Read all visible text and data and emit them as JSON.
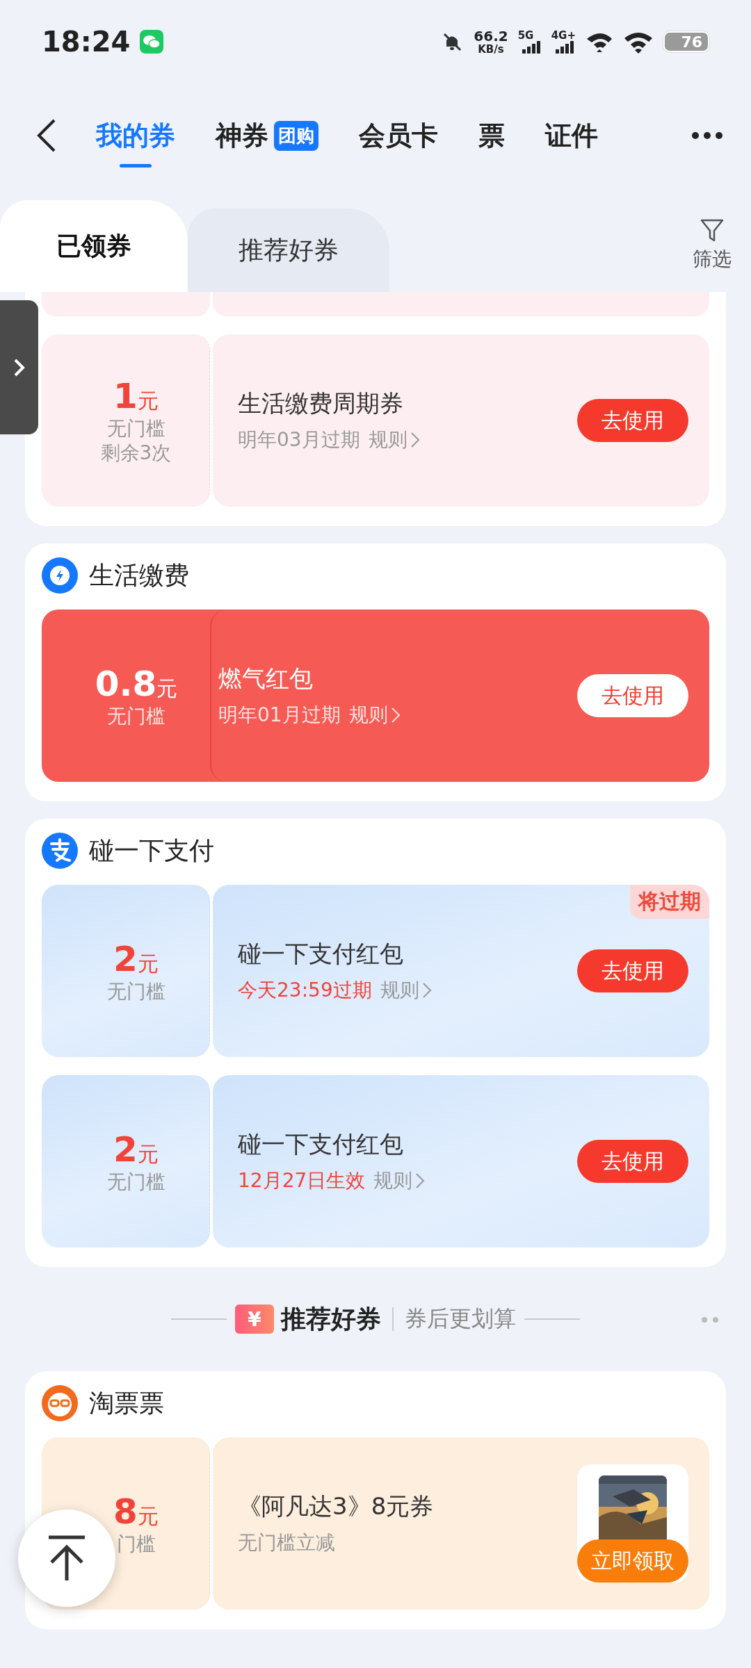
{
  "status_bar": {
    "time": "18:24",
    "net_speed": "66.2",
    "net_unit": "KB/s",
    "sim1": "5G",
    "sim2": "4G+",
    "battery": "76"
  },
  "nav": {
    "tabs": [
      {
        "label": "我的券",
        "selected": true
      },
      {
        "label": "神券",
        "badge": "团购",
        "selected": false
      },
      {
        "label": "会员卡",
        "selected": false
      },
      {
        "label": "票",
        "selected": false
      },
      {
        "label": "证件",
        "selected": false
      }
    ]
  },
  "sub_tabs": [
    {
      "label": "已领券",
      "selected": true
    },
    {
      "label": "推荐好券",
      "selected": false
    }
  ],
  "filter": {
    "label": "筛选"
  },
  "sections": [
    {
      "kind": "continued",
      "clipped_top": true,
      "coupons": [
        {
          "kind": "pink",
          "amount": "1",
          "unit": "元",
          "conditions": [
            "无门槛",
            "剩余3次"
          ],
          "title": "生活缴费周期券",
          "validity": "明年03月过期",
          "validity_alert": false,
          "rules": "规则",
          "button": "去使用"
        }
      ]
    },
    {
      "kind": "utility",
      "title": "生活缴费",
      "coupons": [
        {
          "kind": "red",
          "amount": "0.8",
          "unit": "元",
          "conditions": [
            "无门槛"
          ],
          "title": "燃气红包",
          "validity": "明年01月过期",
          "validity_alert": false,
          "rules": "规则",
          "button": "去使用"
        }
      ]
    },
    {
      "kind": "pay",
      "title": "碰一下支付",
      "coupons": [
        {
          "kind": "blue",
          "amount": "2",
          "unit": "元",
          "conditions": [
            "无门槛"
          ],
          "title": "碰一下支付红包",
          "validity": "今天23:59过期",
          "validity_alert": true,
          "rules": "规则",
          "button": "去使用",
          "tag": "将过期"
        },
        {
          "kind": "blue",
          "amount": "2",
          "unit": "元",
          "conditions": [
            "无门槛"
          ],
          "title": "碰一下支付红包",
          "validity": "12月27日生效",
          "validity_alert": true,
          "rules": "规则",
          "button": "去使用"
        }
      ]
    },
    {
      "kind": "divider",
      "icon_text": "¥",
      "title": "推荐好券",
      "subtitle": "券后更划算"
    },
    {
      "kind": "ticket",
      "title": "淘票票",
      "coupons": [
        {
          "kind": "peach",
          "amount": "8",
          "unit": "元",
          "conditions": [
            "门槛"
          ],
          "title": "《阿凡达3》8元券",
          "subtitle": "无门槛立减",
          "button": "立即领取",
          "poster": {
            "kind": "picture"
          }
        }
      ]
    }
  ]
}
